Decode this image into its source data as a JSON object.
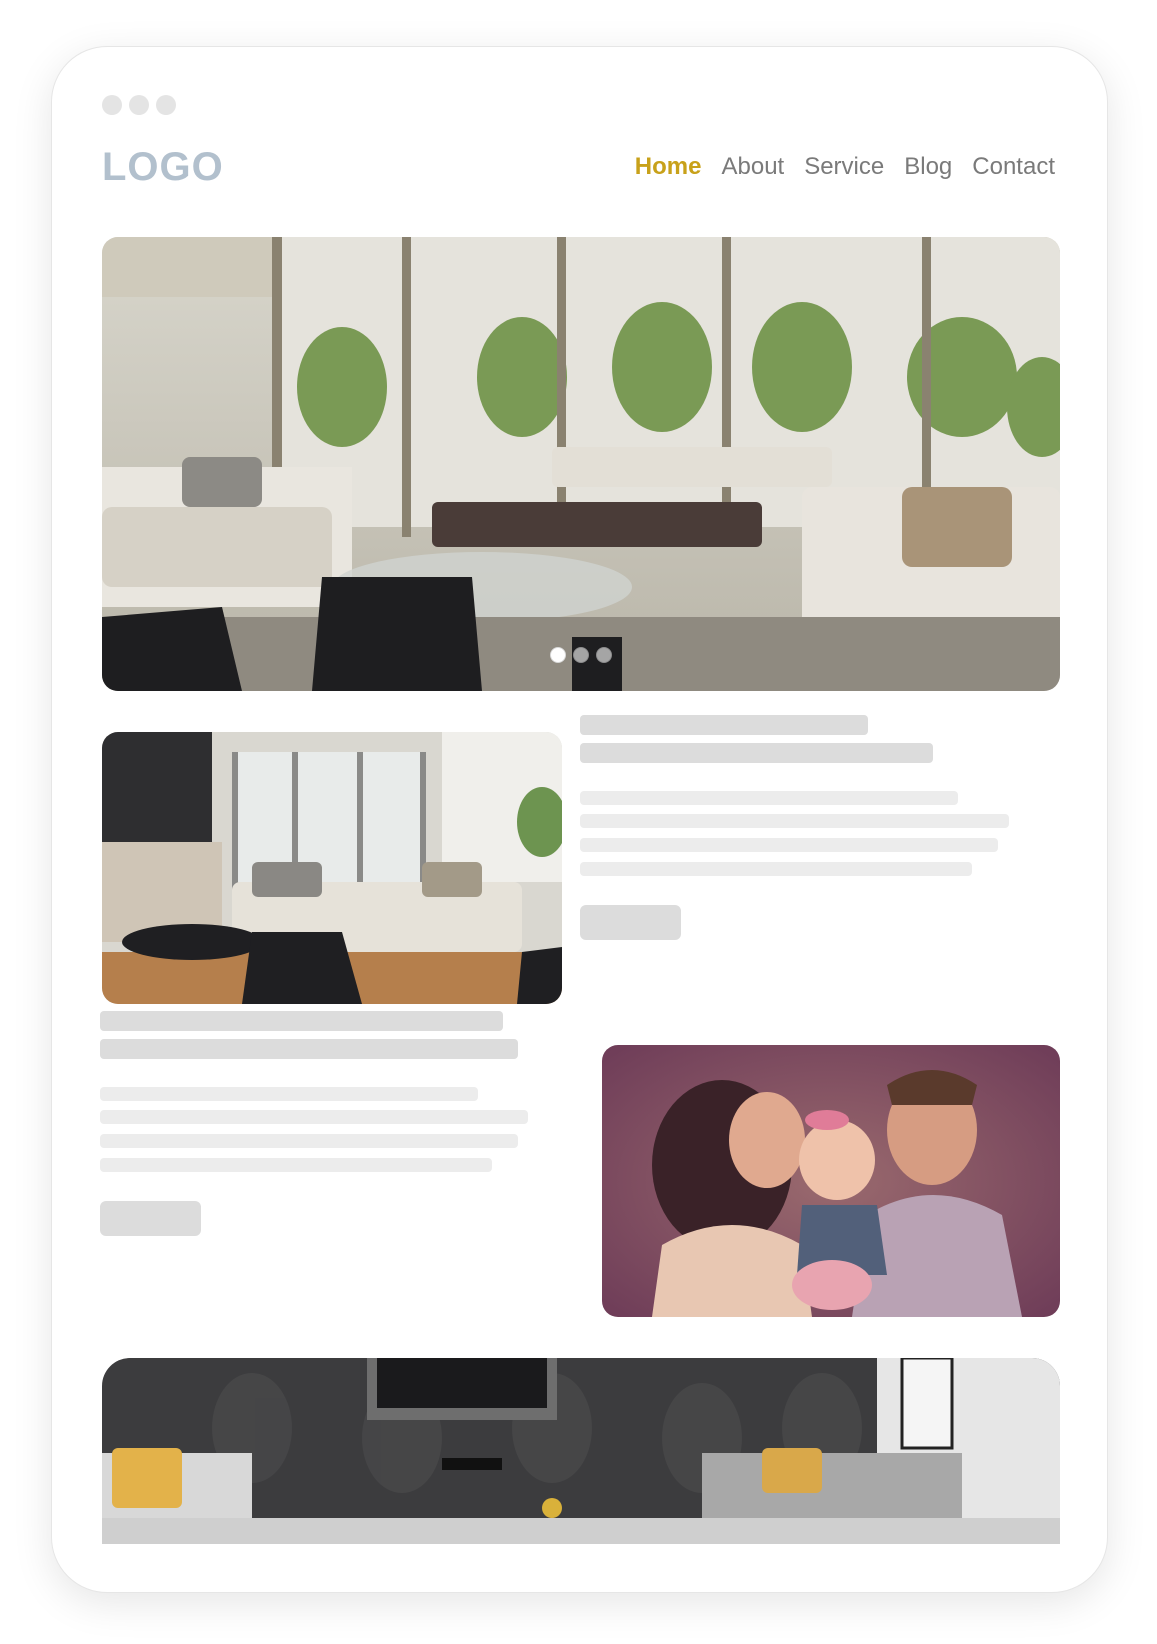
{
  "header": {
    "logo": "LOGO",
    "nav": [
      {
        "label": "Home",
        "active": true
      },
      {
        "label": "About",
        "active": false
      },
      {
        "label": "Service",
        "active": false
      },
      {
        "label": "Blog",
        "active": false
      },
      {
        "label": "Contact",
        "active": false
      }
    ]
  },
  "hero": {
    "image": "living-room-photo",
    "slides": 3,
    "active_slide": 1
  },
  "sections": [
    {
      "image": "lounge-room-photo",
      "image_side": "left"
    },
    {
      "image": "family-kissing-baby-photo",
      "image_side": "right"
    }
  ],
  "footer_banner": {
    "image": "gray-sofa-interior-photo"
  },
  "colors": {
    "accent": "#c8a11a",
    "logo": "#b2c0cd",
    "nav_text": "#7a7a7a",
    "placeholder_dark": "#dcdcdc",
    "placeholder_light": "#ececec"
  }
}
